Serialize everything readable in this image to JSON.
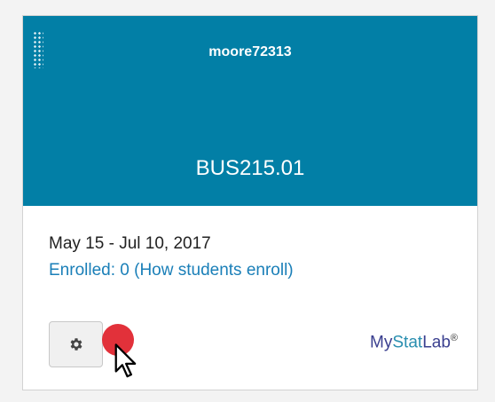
{
  "card": {
    "owner": "moore72313",
    "course_code": "BUS215.01",
    "dates": "May 15 - Jul 10, 2017",
    "enrollment_link": "Enrolled: 0 (How students enroll)",
    "brand": {
      "part1": "My",
      "part2": "Stat",
      "part3": "Lab",
      "reg": "®"
    }
  },
  "icons": {
    "drag": "drag-handle-icon",
    "settings": "gear-icon",
    "cursor": "mouse-pointer-icon"
  },
  "colors": {
    "header": "#027fa6",
    "link": "#1a7fb8",
    "click_marker": "#e2313a"
  }
}
